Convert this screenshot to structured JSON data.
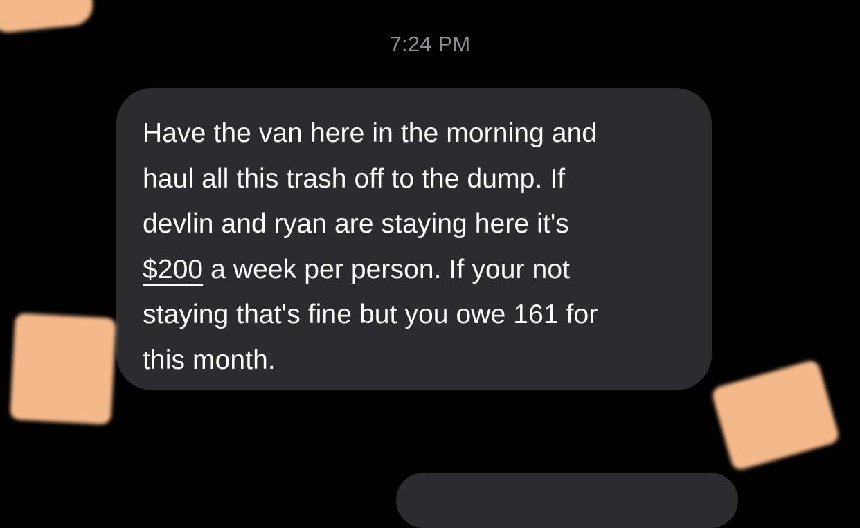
{
  "conversation": {
    "timestamp": "7:24 PM",
    "message": {
      "lines": [
        "Have the van here in the morning and",
        "haul all this trash off to the dump. If",
        "devlin and ryan are staying here it's",
        "a week per person. If your not",
        "staying that's fine but you owe 161 for",
        "this month."
      ],
      "amount_link": "$200"
    }
  },
  "colors": {
    "background": "#000000",
    "bubble_incoming": "#2c2c2e",
    "text_primary": "#ffffff",
    "text_secondary": "#8e8e93",
    "redaction_patch": "#f4b98a"
  }
}
